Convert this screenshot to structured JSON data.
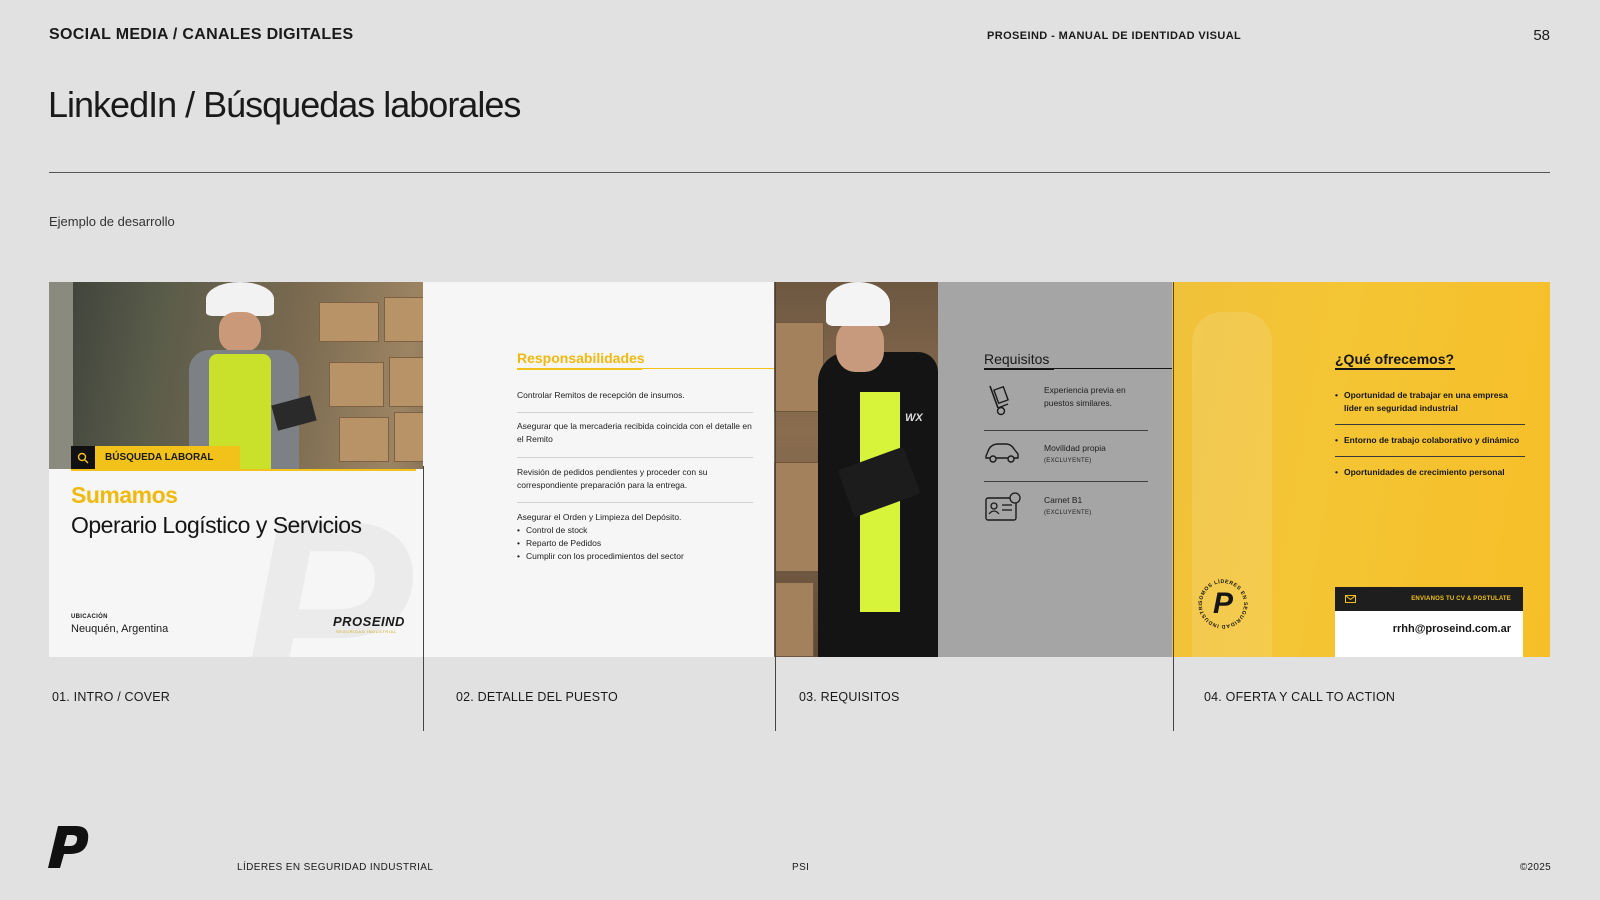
{
  "header": {
    "section": "SOCIAL MEDIA / CANALES DIGITALES",
    "manual": "PROSEIND - MANUAL DE IDENTIDAD VISUAL",
    "page_number": "58"
  },
  "title": "LinkedIn / Búsquedas laborales",
  "subtitle": "Ejemplo de desarrollo",
  "panel1": {
    "tag": "BÚSQUEDA LABORAL",
    "headline_accent": "Sumamos",
    "headline": "Operario Logístico y Servicios",
    "location_label": "UBICACIÓN",
    "location": "Neuquén, Argentina",
    "brand": "PROSEIND",
    "brand_sub": "SEGURIDAD INDUSTRIAL"
  },
  "panel2": {
    "heading": "Responsabilidades",
    "items": [
      "Controlar Remitos de recepción de insumos.",
      "Asegurar que la mercaderia recibida coincida con el detalle en el Remito",
      "Revisión de pedidos pendientes y proceder con su correspondiente preparación para la entrega.",
      "Asegurar el Orden y Limpieza del Depósito."
    ],
    "bullets": [
      "Control de stock",
      "Reparto de Pedidos",
      "Cumplir con los procedimientos del sector"
    ]
  },
  "panel3": {
    "heading": "Requisitos",
    "requirements": [
      {
        "text": "Experiencia previa en puestos similares.",
        "note": ""
      },
      {
        "text": "Movilidad propia",
        "note": "(EXCLUYENTE)"
      },
      {
        "text": "Carnet B1",
        "note": "(EXCLUYENTE)"
      }
    ],
    "icons": [
      "hand-truck-icon",
      "car-icon",
      "license-card-icon"
    ]
  },
  "panel4": {
    "heading": "¿Qué ofrecemos?",
    "offers": [
      "Oportunidad de trabajar en una empresa líder en seguridad industrial",
      "Entorno de trabajo colaborativo y dinámico",
      "Oportunidades de crecimiento personal"
    ],
    "seal_text": "SOMOS LÍDERES EN SEGURIDAD INDUSTRIAL",
    "cta_label": "ENVIANOS TU CV & POSTULATE",
    "email": "rrhh@proseind.com.ar"
  },
  "captions": [
    "01. INTRO / COVER",
    "02. DETALLE DEL PUESTO",
    "03. REQUISITOS",
    "04. OFERTA Y CALL TO ACTION"
  ],
  "footer": {
    "slogan": "LÍDERES EN SEGURIDAD INDUSTRIAL",
    "code": "PSI",
    "copyright": "©2025"
  },
  "colors": {
    "background": "#e1e1e1",
    "accent_yellow": "#f2c21b",
    "dark": "#151515",
    "panel_gray": "#a5a5a5"
  }
}
